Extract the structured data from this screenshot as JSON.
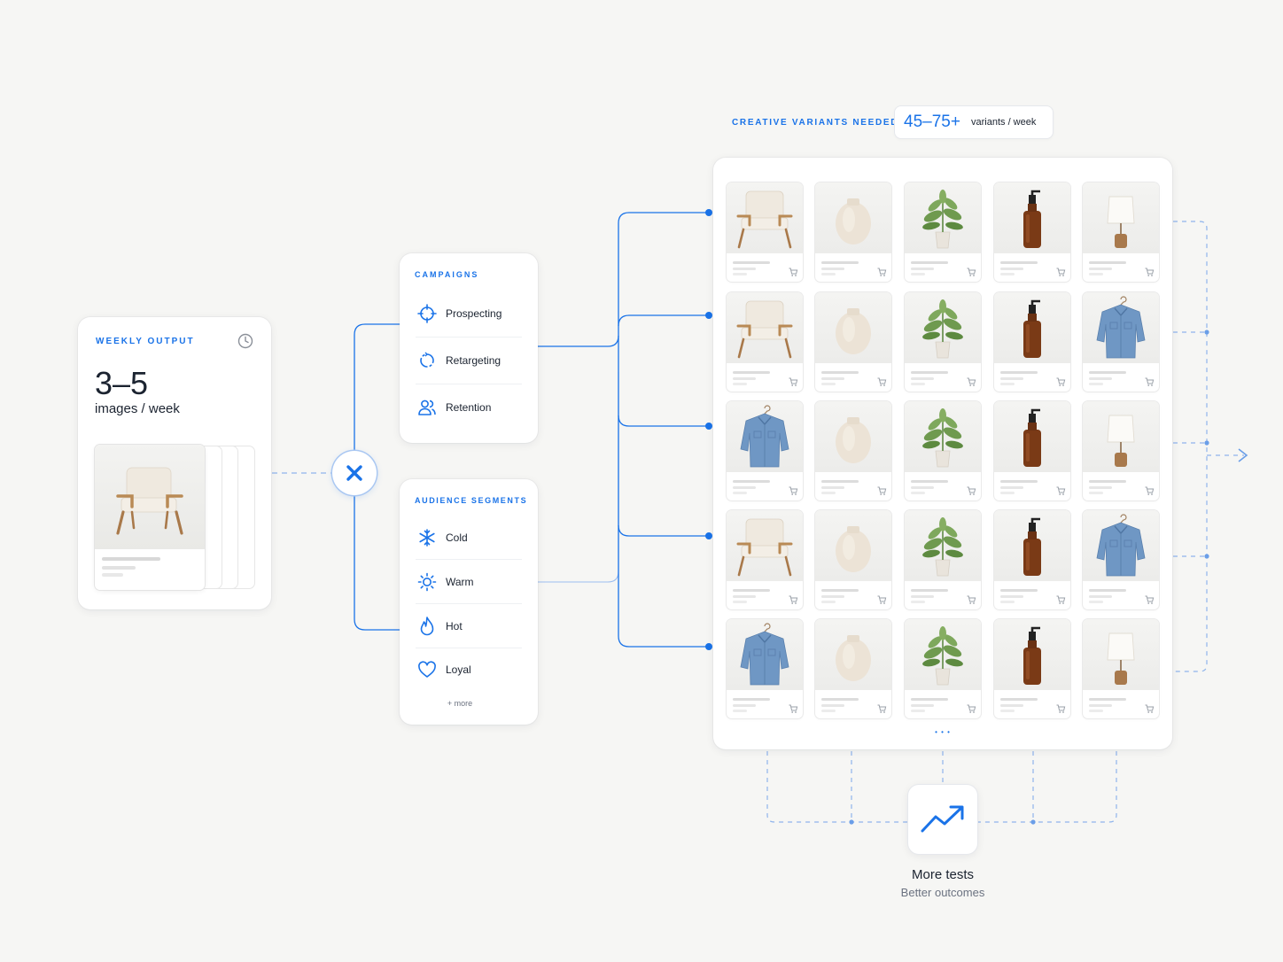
{
  "weekly_output": {
    "eyebrow": "WEEKLY OUTPUT",
    "value": "3–5",
    "unit": "images / week",
    "icon": "clock-icon"
  },
  "campaigns": {
    "eyebrow": "CAMPAIGNS",
    "items": [
      {
        "label": "Prospecting",
        "icon": "crosshair-icon"
      },
      {
        "label": "Retargeting",
        "icon": "refresh-icon"
      },
      {
        "label": "Retention",
        "icon": "users-icon"
      }
    ]
  },
  "audience_segments": {
    "eyebrow": "AUDIENCE SEGMENTS",
    "items": [
      {
        "label": "Cold",
        "icon": "snowflake-icon"
      },
      {
        "label": "Warm",
        "icon": "sun-icon"
      },
      {
        "label": "Hot",
        "icon": "flame-icon"
      },
      {
        "label": "Loyal",
        "icon": "heart-icon"
      }
    ],
    "more": "+ more"
  },
  "multiply": {
    "icon": "multiply-icon"
  },
  "variants": {
    "eyebrow": "CREATIVE VARIANTS NEEDED",
    "value": "45–75+",
    "unit": "variants / week"
  },
  "grid": {
    "rows": [
      [
        "chair",
        "vase",
        "plant",
        "bottle",
        "lamp"
      ],
      [
        "chair",
        "vase",
        "plant",
        "bottle",
        "shirt"
      ],
      [
        "shirt",
        "vase",
        "plant",
        "bottle",
        "lamp"
      ],
      [
        "chair",
        "vase",
        "plant",
        "bottle",
        "shirt"
      ],
      [
        "shirt",
        "vase",
        "plant",
        "bottle",
        "lamp"
      ]
    ],
    "ellipsis": "• • •"
  },
  "outcome": {
    "icon": "trend-up-icon",
    "title": "More tests",
    "subtitle": "Better outcomes"
  },
  "colors": {
    "accent": "#1a73e8",
    "background": "#f6f6f4",
    "card": "#ffffff",
    "text": "#1b2330"
  }
}
